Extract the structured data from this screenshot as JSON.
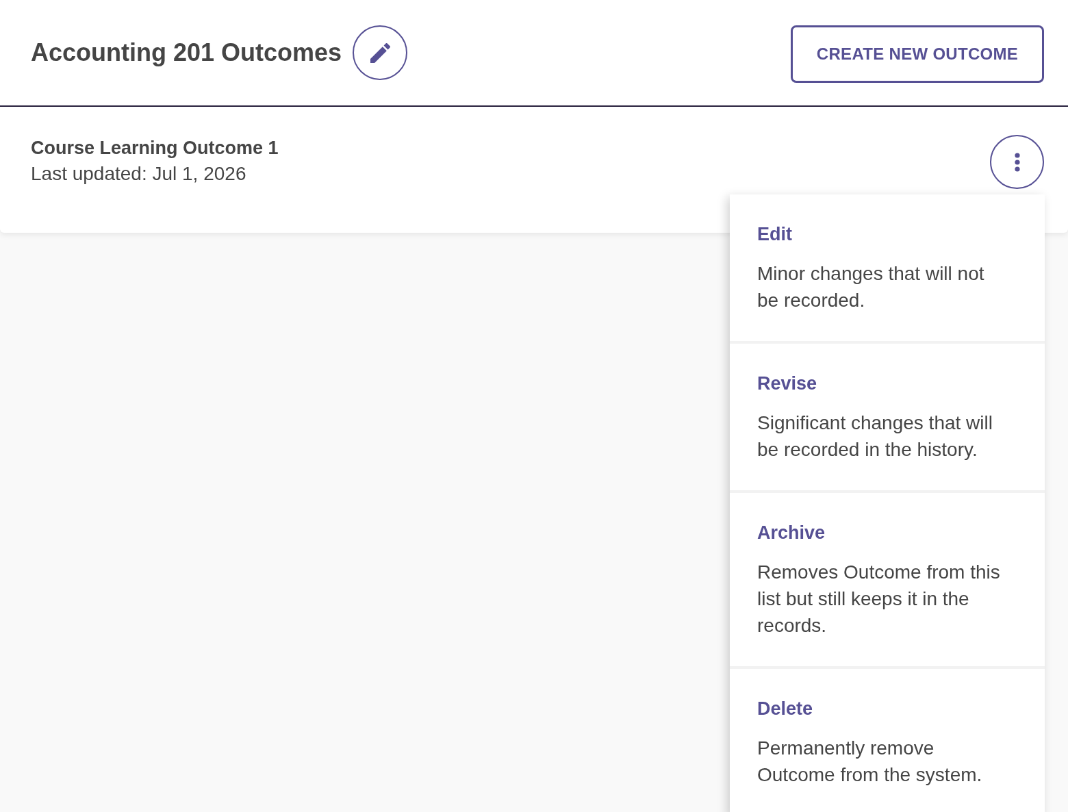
{
  "header": {
    "title": "Accounting 201 Outcomes",
    "create_button": "CREATE NEW OUTCOME"
  },
  "outcomes": [
    {
      "title": "Course Learning Outcome 1",
      "updated": "Last updated: Jul 1, 2026",
      "menu_open": true
    }
  ],
  "menu": {
    "items": [
      {
        "label": "Edit",
        "description": "Minor changes that will not be recorded."
      },
      {
        "label": "Revise",
        "description": "Significant changes that will be recorded in the history."
      },
      {
        "label": "Archive",
        "description": "Removes Outcome from this list but still keeps it in the records."
      },
      {
        "label": "Delete",
        "description": "Permanently remove Outcome from the system."
      }
    ]
  }
}
